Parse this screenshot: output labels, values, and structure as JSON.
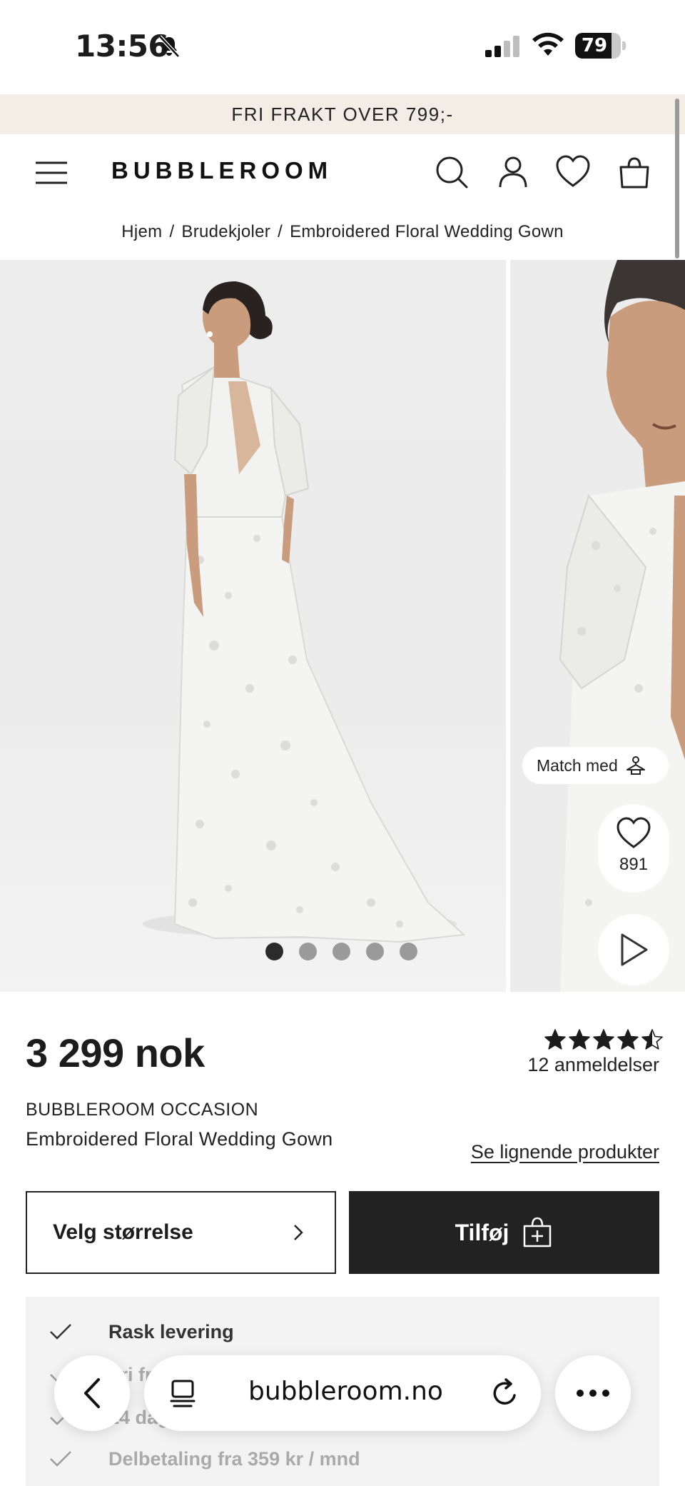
{
  "status_bar": {
    "time": "13:56",
    "battery": "79",
    "battery_level": 0.79
  },
  "promo": {
    "text": "FRI FRAKT OVER 799;-"
  },
  "header": {
    "logo": "BUBBLEROOM"
  },
  "breadcrumb": {
    "items": [
      "Hjem",
      "Brudekjoler",
      "Embroidered Floral Wedding Gown"
    ],
    "separator": "/"
  },
  "gallery": {
    "match_label": "Match med",
    "like_count": "891",
    "dots_total": 5,
    "active_dot": 0
  },
  "product": {
    "price": "3 299 nok",
    "rating": 4.5,
    "rating_max": 5,
    "reviews": "12 anmeldelser",
    "brand": "BUBBLEROOM OCCASION",
    "name": "Embroidered Floral Wedding Gown",
    "similar_link": "Se lignende produkter",
    "size_button": "Velg størrelse",
    "add_button": "Tilføj"
  },
  "benefits": [
    {
      "text": "Rask levering"
    },
    {
      "text": "Fri frakt over 988;-"
    },
    {
      "text": "14 dagers åpent kjøp"
    },
    {
      "text": "Delbetaling fra 359 kr / mnd"
    }
  ],
  "browser": {
    "url": "bubbleroom.no"
  },
  "colors": {
    "promo_bg": "#f3ede6",
    "primary_btn": "#222222",
    "star": "#1c1c1c"
  }
}
